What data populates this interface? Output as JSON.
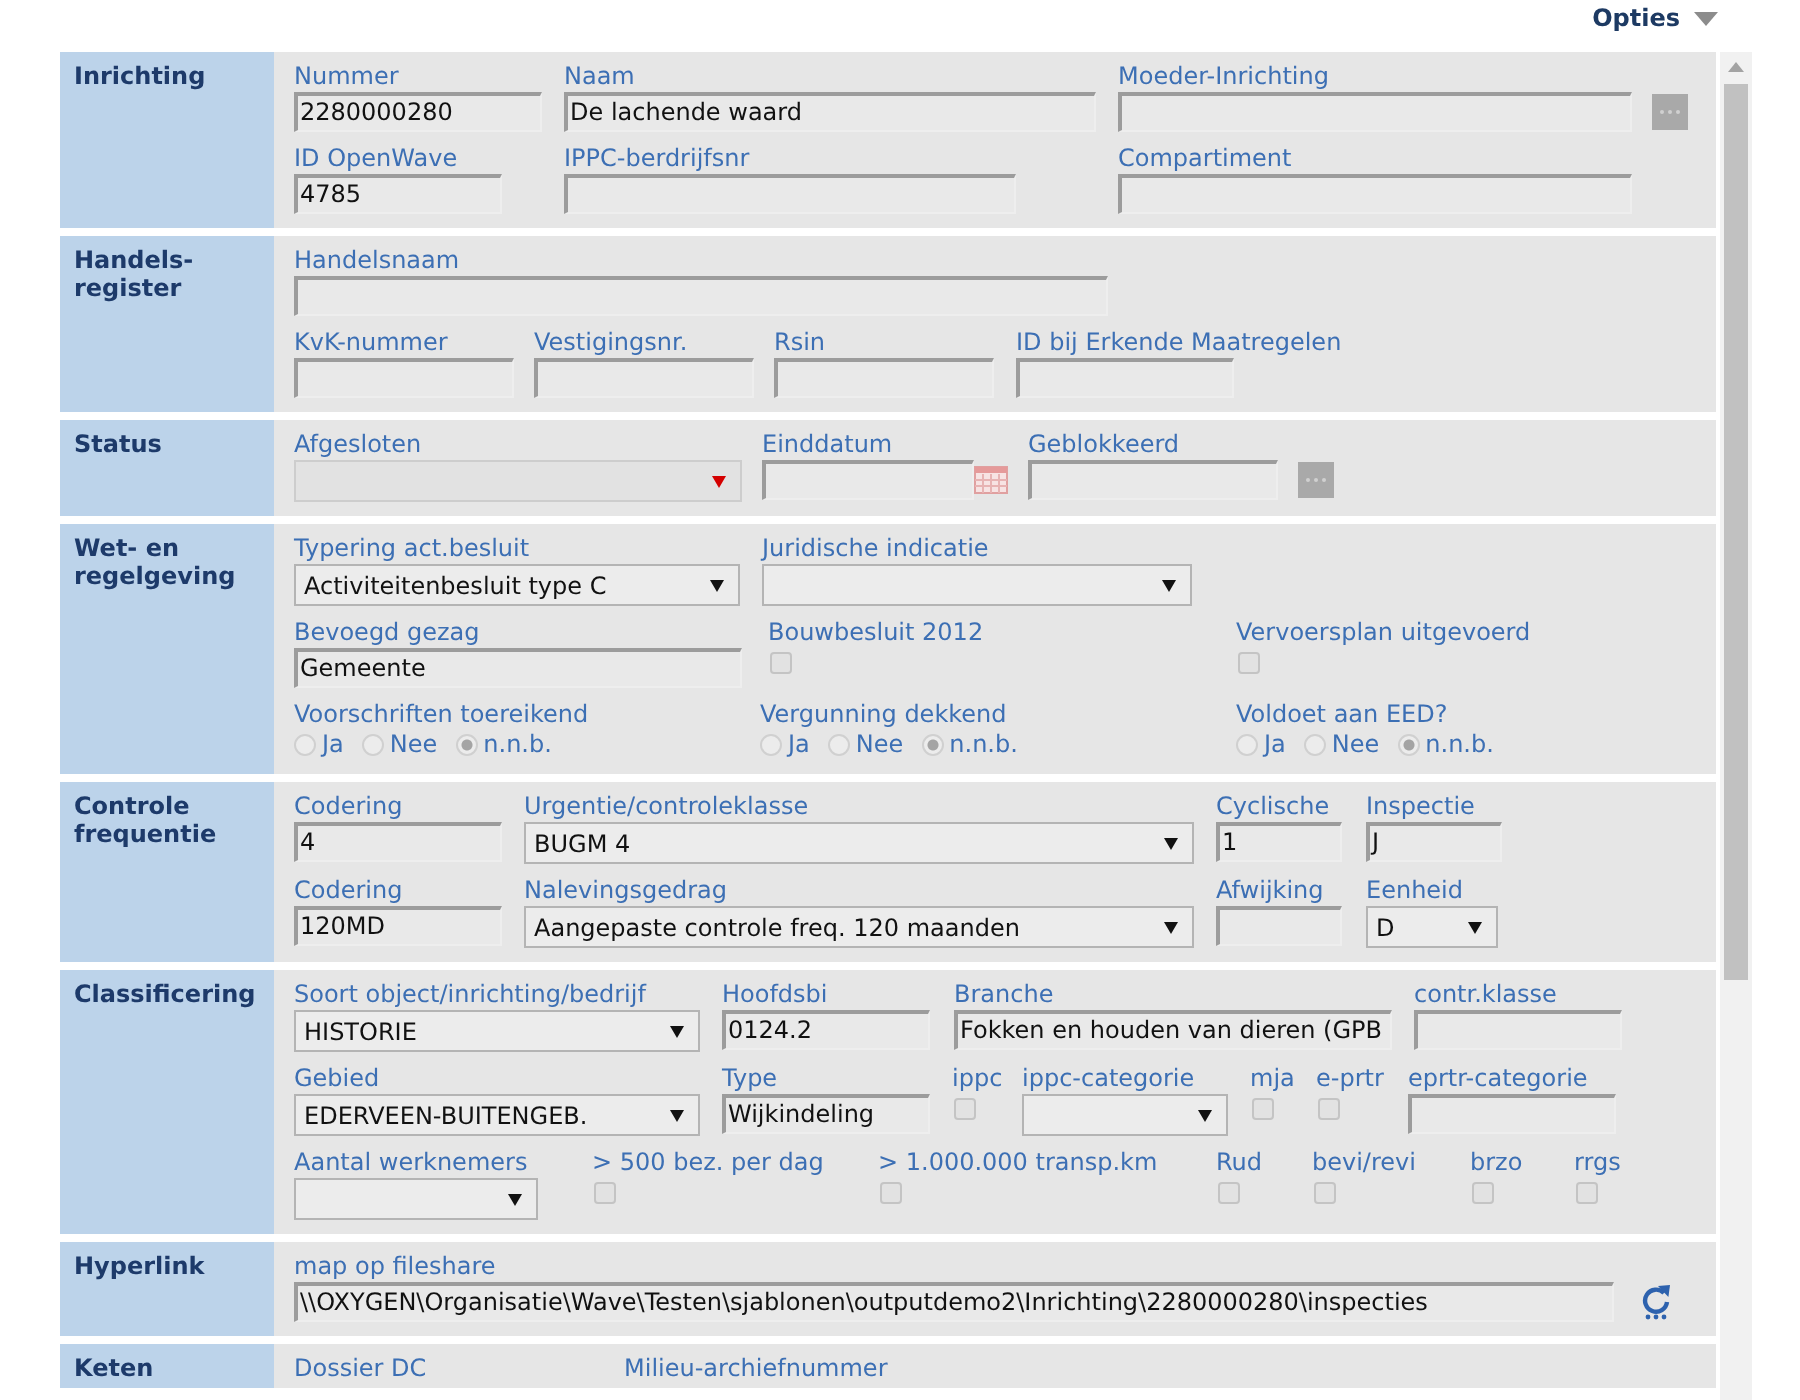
{
  "options_menu": {
    "label": "Opties"
  },
  "sections": [
    {
      "title": "Inrichting",
      "rows": [
        {
          "fields": [
            {
              "kind": "text",
              "label": "Nummer",
              "value": "2280000280"
            },
            {
              "kind": "text",
              "label": "Naam",
              "value": "De lachende waard"
            },
            {
              "kind": "lookup",
              "label": "Moeder-Inrichting"
            }
          ]
        },
        {
          "fields": [
            {
              "kind": "text",
              "label": "ID OpenWave",
              "value": "4785"
            },
            {
              "kind": "text",
              "label": "IPPC-berdrijfsnr"
            },
            {
              "kind": "text",
              "label": "Compartiment"
            }
          ]
        }
      ]
    },
    {
      "title": "Handels-register",
      "rows": [
        {
          "fields": [
            {
              "kind": "text",
              "label": "Handelsnaam"
            }
          ]
        },
        {
          "fields": [
            {
              "kind": "text",
              "label": "KvK-nummer"
            },
            {
              "kind": "text",
              "label": "Vestigingsnr."
            },
            {
              "kind": "text",
              "label": "Rsin"
            },
            {
              "kind": "text",
              "label": "ID bij Erkende Maatregelen"
            }
          ]
        }
      ]
    },
    {
      "title": "Status",
      "rows": [
        {
          "fields": [
            {
              "kind": "picklist",
              "label": "Afgesloten"
            },
            {
              "kind": "date",
              "label": "Einddatum"
            },
            {
              "kind": "lookup",
              "label": "Geblokkeerd"
            }
          ]
        }
      ]
    },
    {
      "title": "Wet- en regelgeving",
      "rows": [
        {
          "fields": [
            {
              "kind": "select",
              "label": "Typering act.besluit",
              "value": "Activiteitenbesluit type C"
            },
            {
              "kind": "select",
              "label": "Juridische indicatie"
            }
          ]
        },
        {
          "fields": [
            {
              "kind": "text",
              "label": "Bevoegd gezag",
              "value": "Gemeente"
            },
            {
              "kind": "checkbox",
              "label": "Bouwbesluit 2012",
              "checked": false
            },
            {
              "kind": "checkbox",
              "label": "Vervoersplan uitgevoerd",
              "checked": false
            }
          ]
        },
        {
          "fields": [
            {
              "kind": "radio",
              "label": "Voorschriften toereikend",
              "options": [
                {
                  "label": "Ja",
                  "selected": false
                },
                {
                  "label": "Nee",
                  "selected": false
                },
                {
                  "label": "n.n.b.",
                  "selected": true
                }
              ]
            },
            {
              "kind": "radio",
              "label": "Vergunning dekkend",
              "options": [
                {
                  "label": "Ja",
                  "selected": false
                },
                {
                  "label": "Nee",
                  "selected": false
                },
                {
                  "label": "n.n.b.",
                  "selected": true
                }
              ]
            },
            {
              "kind": "radio",
              "label": "Voldoet aan EED?",
              "options": [
                {
                  "label": "Ja",
                  "selected": false
                },
                {
                  "label": "Nee",
                  "selected": false
                },
                {
                  "label": "n.n.b.",
                  "selected": true
                }
              ]
            }
          ]
        }
      ]
    },
    {
      "title": "Controle frequentie",
      "rows": [
        {
          "fields": [
            {
              "kind": "text",
              "label": "Codering",
              "value": "4"
            },
            {
              "kind": "select",
              "label": "Urgentie/controleklasse",
              "value": "BUGM 4"
            },
            {
              "kind": "text",
              "label": "Cyclische",
              "value": "1"
            },
            {
              "kind": "text",
              "label": "Inspectie",
              "value": "J"
            }
          ]
        },
        {
          "fields": [
            {
              "kind": "text",
              "label": "Codering",
              "value": "120MD"
            },
            {
              "kind": "select",
              "label": "Nalevingsgedrag",
              "value": "Aangepaste controle freq. 120 maanden"
            },
            {
              "kind": "text",
              "label": "Afwijking"
            },
            {
              "kind": "select",
              "label": "Eenheid",
              "value": "D"
            }
          ]
        }
      ]
    },
    {
      "title": "Classificering",
      "rows": [
        {
          "fields": [
            {
              "kind": "select",
              "label": "Soort object/inrichting/bedrijf",
              "value": "HISTORIE"
            },
            {
              "kind": "text",
              "label": "Hoofdsbi",
              "value": "0124.2"
            },
            {
              "kind": "text",
              "label": "Branche",
              "value": "Fokken en houden van dieren (GPB"
            },
            {
              "kind": "text",
              "label": "contr.klasse"
            }
          ]
        },
        {
          "fields": [
            {
              "kind": "select",
              "label": "Gebied",
              "value": "EDERVEEN-BUITENGEB."
            },
            {
              "kind": "text",
              "label": "Type",
              "value": "Wijkindeling"
            },
            {
              "kind": "checkbox",
              "label": "ippc",
              "checked": false
            },
            {
              "kind": "select",
              "label": "ippc-categorie"
            },
            {
              "kind": "checkbox",
              "label": "mja",
              "checked": false
            },
            {
              "kind": "checkbox",
              "label": "e-prtr",
              "checked": false
            },
            {
              "kind": "text",
              "label": "eprtr-categorie"
            }
          ]
        },
        {
          "fields": [
            {
              "kind": "select",
              "label": "Aantal werknemers"
            },
            {
              "kind": "checkbox",
              "label": "> 500 bez. per dag",
              "checked": false
            },
            {
              "kind": "checkbox",
              "label": "> 1.000.000 transp.km",
              "checked": false
            },
            {
              "kind": "checkbox",
              "label": "Rud",
              "checked": false
            },
            {
              "kind": "checkbox",
              "label": "bevi/revi",
              "checked": false
            },
            {
              "kind": "checkbox",
              "label": "brzo",
              "checked": false
            },
            {
              "kind": "checkbox",
              "label": "rrgs",
              "checked": false
            }
          ]
        }
      ]
    },
    {
      "title": "Hyperlink",
      "rows": [
        {
          "fields": [
            {
              "kind": "link",
              "label": "map op fileshare",
              "value": "\\\\OXYGEN\\Organisatie\\Wave\\Testen\\sjablonen\\outputdemo2\\Inrichting\\2280000280\\inspecties"
            }
          ]
        }
      ]
    },
    {
      "title": "Keten",
      "rows": [
        {
          "fields": [
            {
              "kind": "label",
              "label": "Dossier DC"
            },
            {
              "kind": "label",
              "label": "Milieu-archiefnummer"
            }
          ]
        }
      ]
    }
  ]
}
